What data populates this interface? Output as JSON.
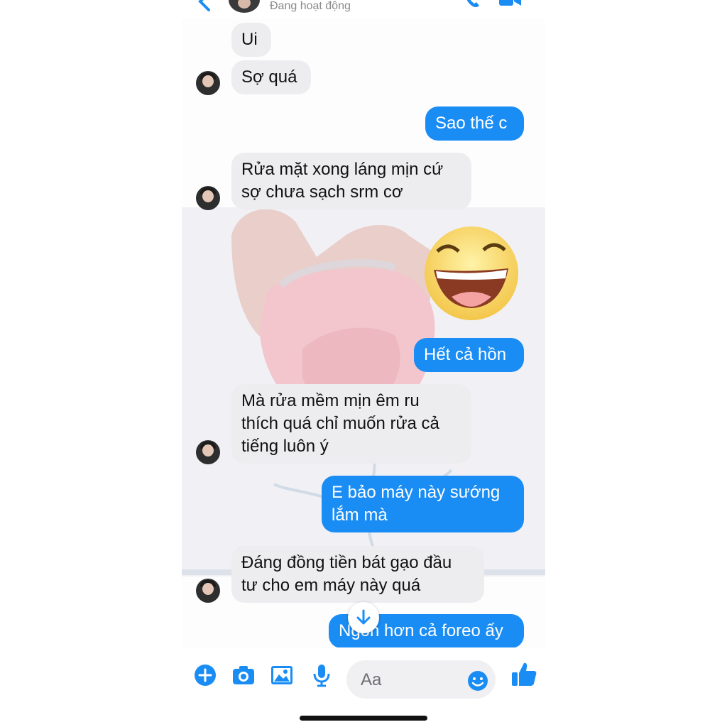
{
  "header": {
    "status": "Đang hoạt động"
  },
  "messages": [
    {
      "from": "them",
      "text": "Ui"
    },
    {
      "from": "them",
      "text": "Sợ quá"
    },
    {
      "from": "me",
      "text": "Sao thế c"
    },
    {
      "from": "them",
      "text": "Rửa mặt xong láng mịn cứ\nsợ chưa sạch srm cơ"
    },
    {
      "from": "me",
      "text": "Hết cả hồn"
    },
    {
      "from": "them",
      "text": "Mà rửa mềm mịn êm ru\nthích quá chỉ muốn rửa cả\ntiếng luôn ý"
    },
    {
      "from": "me",
      "text": "E bảo máy này sướng\nlắm mà"
    },
    {
      "from": "them",
      "text": "Đáng đồng tiền bát gạo đầu\ntư cho em máy này quá"
    },
    {
      "from": "me",
      "text": "Ngon hơn cả foreo ấy"
    }
  ],
  "composer": {
    "placeholder": "Aa"
  },
  "colors": {
    "accent": "#1a8df5",
    "incoming": "#ededf0"
  },
  "icons": [
    "back-arrow-icon",
    "phone-icon",
    "video-icon",
    "plus-icon",
    "camera-icon",
    "gallery-icon",
    "microphone-icon",
    "emoji-icon",
    "thumbs-up-icon",
    "scroll-down-icon"
  ]
}
